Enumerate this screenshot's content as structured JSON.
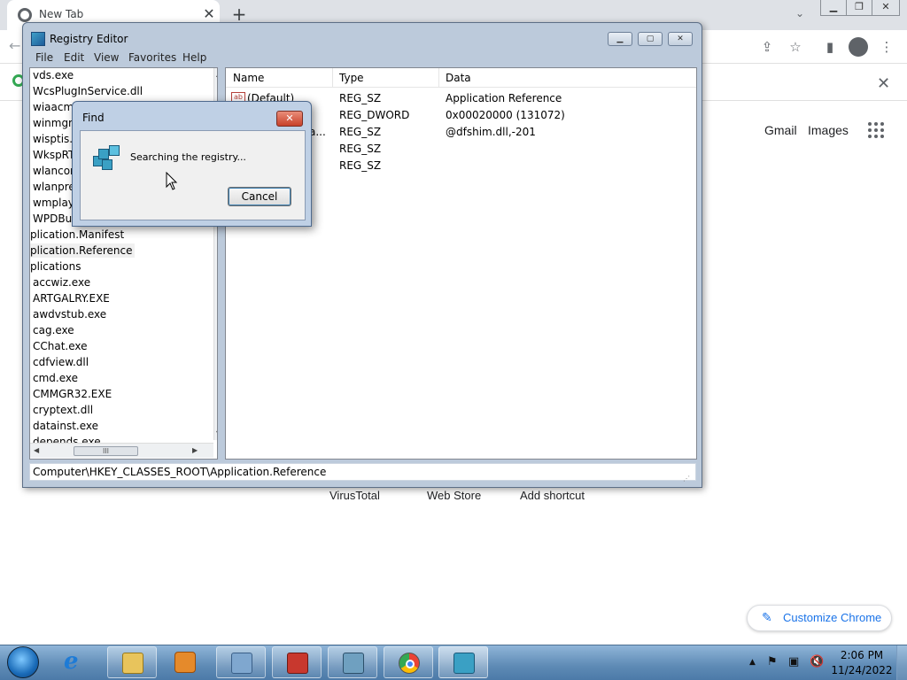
{
  "chrome": {
    "tab_title": "New Tab",
    "tab_close": "✕",
    "new_tab": "+",
    "window_controls": [
      "▁",
      "❐",
      "✕"
    ],
    "toolbar_icons": [
      "share-icon",
      "star-icon",
      "sidebar-icon",
      "profile-icon",
      "menu-icon"
    ],
    "infobar_close": "✕",
    "links": {
      "gmail": "Gmail",
      "images": "Images"
    },
    "shortcuts": [
      "VirusTotal",
      "Web Store",
      "Add shortcut"
    ],
    "customize": "Customize Chrome"
  },
  "regedit": {
    "title": "Registry Editor",
    "menu": [
      "File",
      "Edit",
      "View",
      "Favorites",
      "Help"
    ],
    "tree_items": [
      "vds.exe",
      "WcsPlugInService.dll",
      "wiaacmg",
      "winmgm",
      "wisptis.E",
      "WkspRT",
      "wlancon",
      "wlanpref",
      "wmplaye",
      "WPDBus",
      "plication.Manifest",
      "plication.Reference",
      "plications",
      "accwiz.exe",
      "ARTGALRY.EXE",
      "awdvstub.exe",
      "cag.exe",
      "CChat.exe",
      "cdfview.dll",
      "cmd.exe",
      "CMMGR32.EXE",
      "cryptext.dll",
      "datainst.exe",
      "depends.exe"
    ],
    "selected_tree_item": "plication.Reference",
    "columns": {
      "name": "Name",
      "type": "Type",
      "data": "Data"
    },
    "values": [
      {
        "name": "(Default)",
        "type": "REG_SZ",
        "data": "Application Reference"
      },
      {
        "name": "",
        "type": "REG_DWORD",
        "data": "0x00020000 (131072)"
      },
      {
        "name": "a...",
        "type": "REG_SZ",
        "data": "@dfshim.dll,-201"
      },
      {
        "name": "",
        "type": "REG_SZ",
        "data": ""
      },
      {
        "name": "",
        "type": "REG_SZ",
        "data": ""
      }
    ],
    "status_path": "Computer\\HKEY_CLASSES_ROOT\\Application.Reference",
    "hscroll_thumb": "III"
  },
  "find_dialog": {
    "title": "Find",
    "message": "Searching the registry...",
    "cancel": "Cancel",
    "close": "✕"
  },
  "taskbar": {
    "apps": [
      "internet-explorer",
      "file-explorer",
      "media-player",
      "control-panel",
      "toolbox",
      "picture-viewer",
      "chrome",
      "registry-editor"
    ],
    "time": "2:06 PM",
    "date": "11/24/2022",
    "tray": [
      "▲",
      "⚑",
      "▣",
      "🔇"
    ]
  }
}
